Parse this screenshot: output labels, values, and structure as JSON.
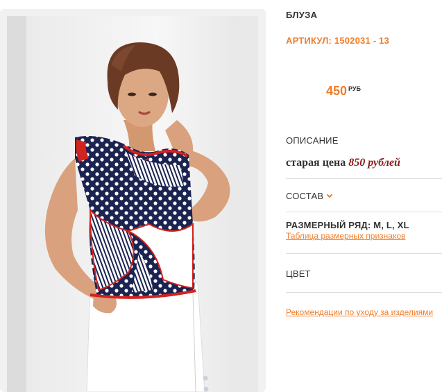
{
  "product": {
    "title": "БЛУЗА",
    "sku": "АРТИКУЛ: 1502031 - 13",
    "price": "450",
    "currency": "РУБ"
  },
  "description": {
    "label": "ОПИСАНИЕ",
    "old_price_prefix": "старая цена",
    "old_price_value": "850 рублей"
  },
  "composition": {
    "label": "СОСТАВ"
  },
  "sizes": {
    "label": "РАЗМЕРНЫЙ РЯД: M, L, XL",
    "chart_link": "Таблица размерных признаков"
  },
  "color": {
    "label": "ЦВЕТ"
  },
  "care": {
    "link": "Рекомендации по уходу за изделиями"
  },
  "colors": {
    "accent": "#f07d2a",
    "old_price": "#8b1a1a",
    "blouse_navy": "#1b2350",
    "blouse_red": "#d2231f"
  },
  "icons": {
    "composition_toggle": "chevron-down-icon"
  }
}
